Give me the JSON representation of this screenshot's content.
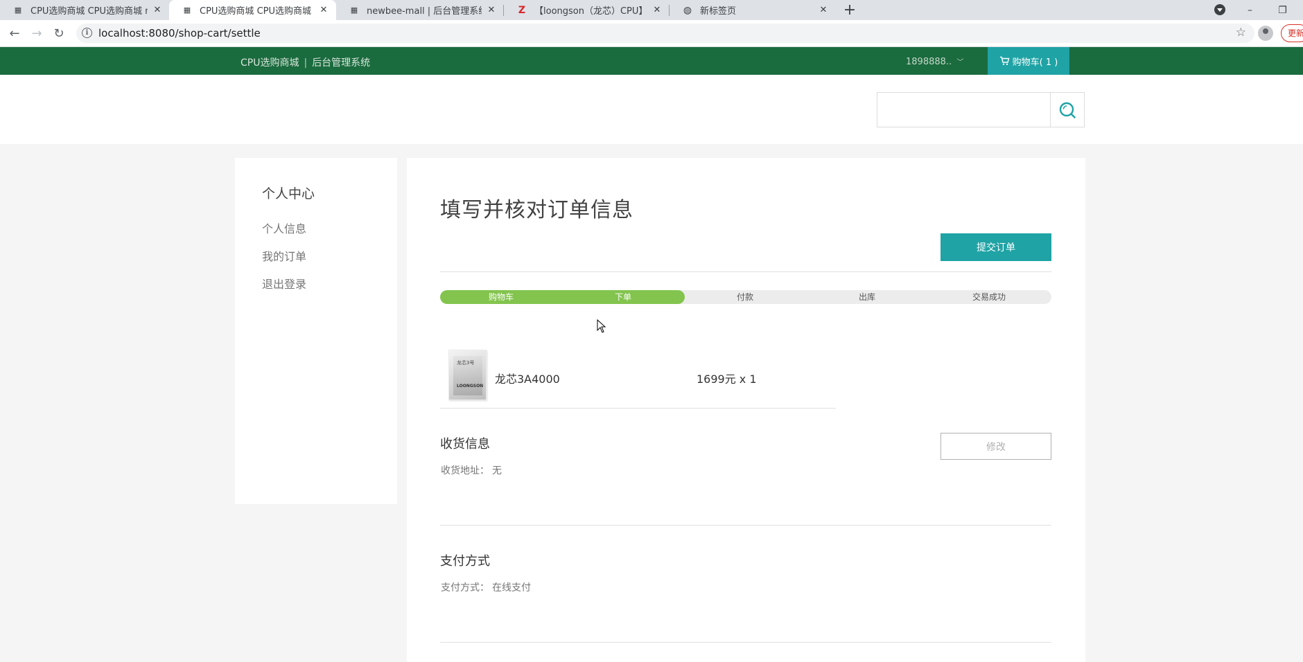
{
  "browser": {
    "tabs": [
      {
        "title": "CPU选购商城 CPU选购商城 new"
      },
      {
        "title": "CPU选购商城 CPU选购商城 new"
      },
      {
        "title": "newbee-mall | 后台管理系统"
      },
      {
        "title": "【loongson（龙芯）CPU】loon"
      },
      {
        "title": "新标签页"
      }
    ],
    "url": "localhost:8080/shop-cart/settle",
    "update_label": "更新"
  },
  "header": {
    "brand": "CPU选购商城",
    "separator": "|",
    "admin_link": "后台管理系统",
    "user": "1898888..",
    "cart_label": "购物车( 1 )"
  },
  "search": {
    "placeholder": ""
  },
  "sidebar": {
    "title": "个人中心",
    "items": [
      {
        "label": "个人信息"
      },
      {
        "label": "我的订单"
      },
      {
        "label": "退出登录"
      }
    ]
  },
  "main": {
    "title": "填写并核对订单信息",
    "submit_label": "提交订单",
    "progress": {
      "completed_fraction": 0.4,
      "steps": [
        "购物车",
        "下单",
        "付款",
        "出库",
        "交易成功"
      ]
    },
    "goods": {
      "image_text_1": "龙芯3号",
      "image_text_2": "LOONGSON",
      "name": "龙芯3A4000",
      "price": "1699元 x 1"
    },
    "shipping": {
      "title": "收货信息",
      "address_label": "收货地址：",
      "address_value": "无",
      "edit_label": "修改"
    },
    "payment": {
      "title": "支付方式",
      "method_label": "支付方式：",
      "method_value": "在线支付"
    }
  },
  "colors": {
    "header_green": "#1a6b3e",
    "accent_teal": "#1fa3a5",
    "progress_green": "#83c44e"
  }
}
